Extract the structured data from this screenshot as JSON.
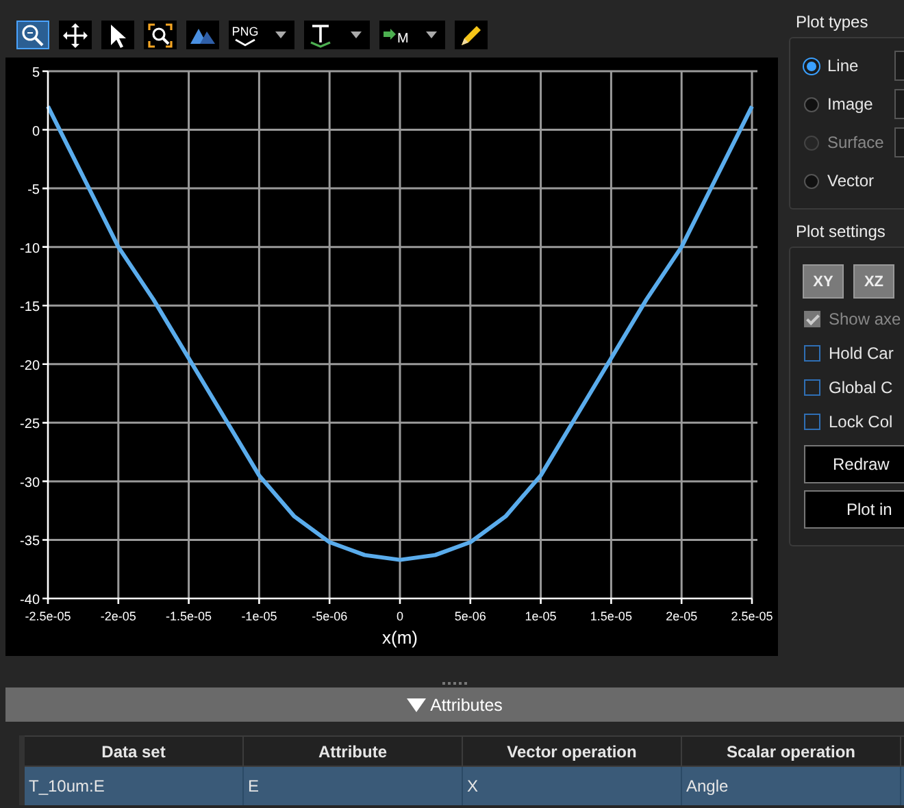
{
  "toolbar": [
    {
      "kind": "button",
      "selected": true
    },
    {
      "kind": "button",
      "selected": false
    },
    {
      "kind": "button",
      "selected": false
    },
    {
      "kind": "button",
      "selected": false
    },
    {
      "kind": "button",
      "selected": false
    },
    {
      "kind": "dropdown",
      "selected": false,
      "label": "PNG"
    },
    {
      "kind": "dropdown",
      "selected": false
    },
    {
      "kind": "dropdown",
      "selected": false,
      "label": "M"
    },
    {
      "kind": "button",
      "selected": false
    }
  ],
  "plot": {
    "chart_data": {
      "type": "line",
      "xlabel": "x(m)",
      "x": [
        -2.5e-05,
        -2.25e-05,
        -2e-05,
        -1.75e-05,
        -1.5e-05,
        -1.25e-05,
        -1e-05,
        -7.5e-06,
        -5e-06,
        -2.5e-06,
        0,
        2.5e-06,
        5e-06,
        7.5e-06,
        1e-05,
        1.25e-05,
        1.5e-05,
        1.75e-05,
        2e-05,
        2.25e-05,
        2.5e-05
      ],
      "series": [
        {
          "color": "#5aacec",
          "values": [
            2,
            -4,
            -10,
            -14.5,
            -19.5,
            -24.5,
            -29.5,
            -33,
            -35.2,
            -36.3,
            -36.7,
            -36.3,
            -35.2,
            -33,
            -29.5,
            -24.5,
            -19.5,
            -14.5,
            -10,
            -4,
            2
          ]
        }
      ],
      "grid": true,
      "xlim": [
        -2.5e-05,
        2.5e-05
      ],
      "ylim": [
        -40,
        5
      ],
      "xticks": [
        {
          "value": -2.5e-05,
          "label": "-2.5e-05"
        },
        {
          "value": -2e-05,
          "label": "-2e-05"
        },
        {
          "value": -1.5e-05,
          "label": "-1.5e-05"
        },
        {
          "value": -1e-05,
          "label": "-1e-05"
        },
        {
          "value": -5e-06,
          "label": "-5e-06"
        },
        {
          "value": 0,
          "label": "0"
        },
        {
          "value": 5e-06,
          "label": "5e-06"
        },
        {
          "value": 1e-05,
          "label": "1e-05"
        },
        {
          "value": 1.5e-05,
          "label": "1.5e-05"
        },
        {
          "value": 2e-05,
          "label": "2e-05"
        },
        {
          "value": 2.5e-05,
          "label": "2.5e-05"
        }
      ],
      "yticks": [
        5,
        0,
        -5,
        -10,
        -15,
        -20,
        -25,
        -30,
        -35,
        -40
      ]
    }
  },
  "plot_types": {
    "title": "Plot types",
    "options": [
      {
        "label": "Line",
        "selected": true,
        "disabled": false
      },
      {
        "label": "Image",
        "selected": false,
        "disabled": false
      },
      {
        "label": "Surface",
        "selected": false,
        "disabled": true
      },
      {
        "label": "Vector",
        "selected": false,
        "disabled": false
      }
    ]
  },
  "plot_settings": {
    "title": "Plot settings",
    "view_buttons": [
      "XY",
      "XZ"
    ],
    "checkboxes": [
      {
        "label": "Show axe",
        "checked": true,
        "disabled": true
      },
      {
        "label": "Hold Car",
        "checked": false,
        "disabled": false
      },
      {
        "label": "Global C",
        "checked": false,
        "disabled": false
      },
      {
        "label": "Lock Col",
        "checked": false,
        "disabled": false
      }
    ],
    "buttons": [
      "Redraw",
      "Plot in"
    ]
  },
  "attributes": {
    "title": "Attributes",
    "expanded": true,
    "columns": [
      "Data set",
      "Attribute",
      "Vector operation",
      "Scalar operation"
    ],
    "rows": [
      {
        "selected": true,
        "cells": [
          "T_10um:E",
          "E",
          "X",
          "Angle"
        ]
      }
    ]
  }
}
